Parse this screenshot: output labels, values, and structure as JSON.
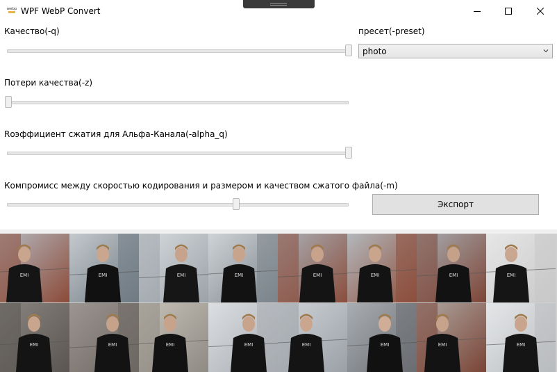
{
  "window": {
    "title": "WPF WebP Convert",
    "icon_text": "webp"
  },
  "controls": {
    "quality": {
      "label": "Качество(-q)",
      "value_fraction": 1.0
    },
    "lossless": {
      "label": "Потери качества(-z)",
      "value_fraction": 0.0
    },
    "alpha": {
      "label": "Rоэффициент сжатия для Альфа-Канала(-alpha_q)",
      "value_fraction": 1.0
    },
    "method": {
      "label": "Компромисс между скоростью кодирования и размером и качеством сжатого файла(-m)",
      "value_fraction": 0.67
    },
    "preset": {
      "label": "пресет(-preset)",
      "value": "photo"
    },
    "export_label": "Экспорт"
  },
  "gallery": {
    "photos": [
      {
        "bg": "#8b4a38",
        "bg2": "#b5b8be",
        "person": "#151515",
        "skin": "#c9a58d"
      },
      {
        "bg": "#6f7a83",
        "bg2": "#c4c9cd",
        "person": "#111",
        "skin": "#caa68e"
      },
      {
        "bg": "#9aa2a8",
        "bg2": "#d8dbde",
        "person": "#161616",
        "skin": "#c7a38b"
      },
      {
        "bg": "#7c858c",
        "bg2": "#cfd3d6",
        "person": "#121212",
        "skin": "#c9a48c"
      },
      {
        "bg": "#8a4d3c",
        "bg2": "#aab0b6",
        "person": "#141414",
        "skin": "#c8a28a"
      },
      {
        "bg": "#8d4f3d",
        "bg2": "#b3b7bb",
        "person": "#131313",
        "skin": "#c9a58c"
      },
      {
        "bg": "#7d4536",
        "bg2": "#a8adb2",
        "person": "#121212",
        "skin": "#c6a189"
      },
      {
        "bg": "#c8c8c8",
        "bg2": "#e6e6e6",
        "person": "#151515",
        "skin": "#c9a68f"
      },
      {
        "bg": "#5a5552",
        "bg2": "#8a8580",
        "person": "#141414",
        "skin": "#caa58d"
      },
      {
        "bg": "#6d6763",
        "bg2": "#9c9590",
        "person": "#131313",
        "skin": "#c7a28a"
      },
      {
        "bg": "#8e8a84",
        "bg2": "#c7c2b8",
        "person": "#121212",
        "skin": "#c8a38b"
      },
      {
        "bg": "#a7acb1",
        "bg2": "#dcdfe2",
        "person": "#131313",
        "skin": "#c9a48c"
      },
      {
        "bg": "#9aa0a6",
        "bg2": "#d0d4d8",
        "person": "#141414",
        "skin": "#caa68e"
      },
      {
        "bg": "#6b6e72",
        "bg2": "#a9adb1",
        "person": "#111",
        "skin": "#d0ad96"
      },
      {
        "bg": "#7a4436",
        "bg2": "#b0a9a4",
        "person": "#131313",
        "skin": "#c8a38b"
      },
      {
        "bg": "#b9bcbf",
        "bg2": "#e4e6e8",
        "person": "#151515",
        "skin": "#c9a58d"
      }
    ]
  }
}
